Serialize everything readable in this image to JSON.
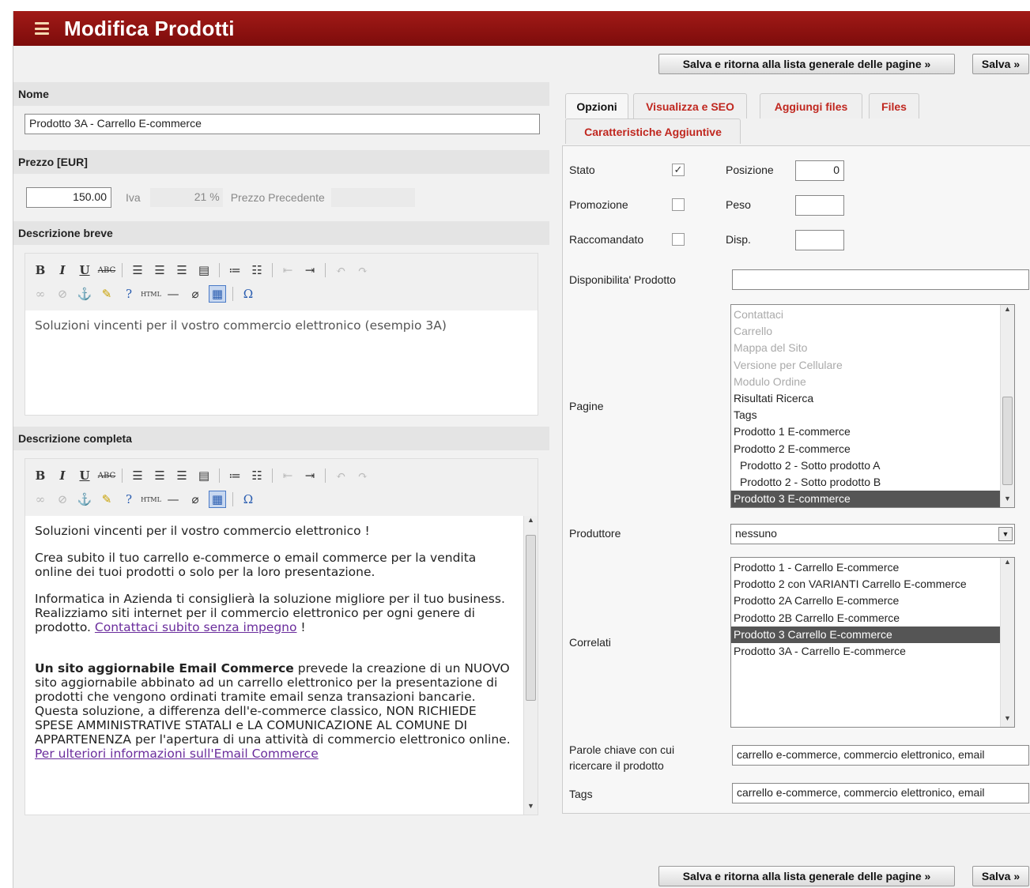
{
  "header": {
    "title": "Modifica Prodotti"
  },
  "buttons": {
    "save_return": "Salva e ritorna alla lista generale delle pagine »",
    "save": "Salva »"
  },
  "left": {
    "nome": {
      "label": "Nome",
      "value": "Prodotto 3A - Carrello E-commerce"
    },
    "prezzo": {
      "label": "Prezzo [EUR]",
      "price": "150.00",
      "iva_label": "Iva",
      "iva_value": "21 %",
      "prev_label": "Prezzo Precedente",
      "prev_value": ""
    },
    "desc_breve": {
      "label": "Descrizione breve",
      "content": "Soluzioni vincenti per il vostro commercio elettronico (esempio 3A)"
    },
    "desc_completa": {
      "label": "Descrizione completa",
      "p1": "Soluzioni vincenti per il vostro commercio elettronico !",
      "p2": "Crea subito il tuo carrello e-commerce o email commerce per la vendita online dei tuoi prodotti o solo per la loro presentazione.",
      "p3_text": "Informatica in Azienda ti consiglierà la soluzione migliore per il tuo business.  Realizziamo siti internet per il commercio elettronico per ogni genere di prodotto. ",
      "p3_link": "Contattaci subito senza impegno",
      "p3_end": " !",
      "p4_bold": "Un sito aggiornabile Email Commerce",
      "p4_text": " prevede la creazione di un NUOVO sito aggiornabile abbinato ad un carrello elettronico per la presentazione di prodotti che vengono ordinati tramite email senza transazioni bancarie. Questa soluzione, a differenza dell'e-commerce classico, NON RICHIEDE SPESE AMMINISTRATIVE STATALI e LA COMUNICAZIONE AL COMUNE DI APPARTENENZA per l'apertura di una attività di commercio elettronico online. ",
      "p4_link": "Per ulteriori informazioni sull'Email Commerce"
    }
  },
  "tabs": [
    "Opzioni",
    "Visualizza e SEO",
    "Aggiungi files",
    "Files",
    "Caratteristiche Aggiuntive"
  ],
  "opzioni": {
    "stato": "Stato",
    "stato_checked": true,
    "promozione": "Promozione",
    "promozione_checked": false,
    "raccomandato": "Raccomandato",
    "raccomandato_checked": false,
    "posizione": "Posizione",
    "posizione_value": "0",
    "peso": "Peso",
    "peso_value": "",
    "disp": "Disp.",
    "disp_value": "",
    "disponibilita": "Disponibilita' Prodotto",
    "disponibilita_value": "",
    "pagine": "Pagine",
    "pagine_options": [
      {
        "t": "Contattaci",
        "s": "dis"
      },
      {
        "t": "Carrello",
        "s": "dis"
      },
      {
        "t": "Mappa del Sito",
        "s": "dis"
      },
      {
        "t": "Versione per Cellulare",
        "s": "dis"
      },
      {
        "t": "Modulo Ordine",
        "s": "dis"
      },
      {
        "t": "Risultati Ricerca",
        "s": ""
      },
      {
        "t": "Tags",
        "s": ""
      },
      {
        "t": "Prodotto 1 E-commerce",
        "s": ""
      },
      {
        "t": "Prodotto 2 E-commerce",
        "s": ""
      },
      {
        "t": "Prodotto 2 - Sotto prodotto A",
        "s": "ind"
      },
      {
        "t": "Prodotto 2 - Sotto prodotto B",
        "s": "ind"
      },
      {
        "t": "Prodotto 3 E-commerce",
        "s": "sel"
      }
    ],
    "produttore": "Produttore",
    "produttore_value": "nessuno",
    "correlati": "Correlati",
    "correlati_options": [
      {
        "t": "Prodotto 1 - Carrello E-commerce",
        "s": ""
      },
      {
        "t": "Prodotto 2 con VARIANTI Carrello E-commerce",
        "s": ""
      },
      {
        "t": "Prodotto 2A Carrello E-commerce",
        "s": ""
      },
      {
        "t": "Prodotto 2B Carrello E-commerce",
        "s": ""
      },
      {
        "t": "Prodotto 3 Carrello E-commerce",
        "s": "sel"
      },
      {
        "t": "Prodotto 3A - Carrello E-commerce",
        "s": ""
      }
    ],
    "parole_chiave": "Parole chiave con cui ricercare il prodotto",
    "parole_value": "carrello e-commerce, commercio elettronico, email",
    "tags": "Tags",
    "tags_value": "carrello e-commerce, commercio elettronico, email"
  }
}
